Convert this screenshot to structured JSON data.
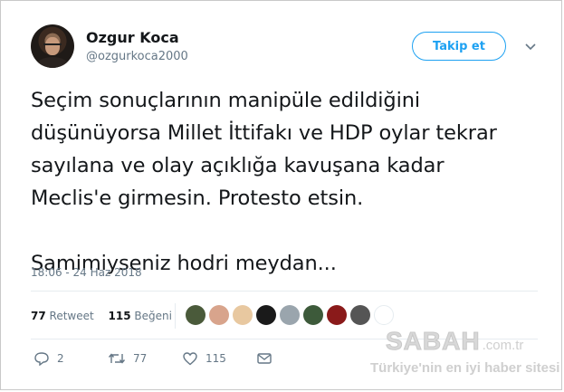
{
  "user": {
    "name": "Ozgur Koca",
    "handle": "@ozgurkoca2000"
  },
  "follow_label": "Takip et",
  "tweet_lines": [
    "Seçim sonuçlarının manipüle edildiğini",
    "düşünüyorsa Millet İttifakı ve HDP oylar tekrar",
    "sayılana ve olay açıklığa kavuşana kadar",
    "Meclis'e girmesin. Protesto etsin.",
    "",
    "Samimiyseniz hodri meydan..."
  ],
  "timestamp": "18:06 - 24 Haz 2018",
  "stats": {
    "retweets": "77",
    "retweets_label": "Retweet",
    "likes": "115",
    "likes_label": "Beğeni"
  },
  "liker_colors": [
    "#4a5a3a",
    "#d8a48c",
    "#e8c8a0",
    "#1a1a1a",
    "#9aa5ad",
    "#3d5a3a",
    "#8a1a1a",
    "#555555",
    "#ffffff"
  ],
  "actions": {
    "replies": "2",
    "retweets": "77",
    "likes": "115"
  },
  "watermark": {
    "logo": "SABAH",
    "domain": ".com.tr",
    "tagline": "Türkiye'nin en iyi haber sitesi"
  },
  "colors": {
    "accent": "#1da1f2",
    "muted": "#657786",
    "text": "#14171a"
  }
}
